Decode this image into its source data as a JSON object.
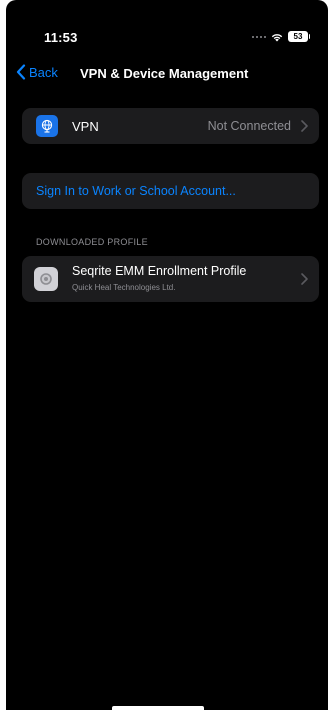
{
  "status_bar": {
    "time": "11:53",
    "battery": "53",
    "wifi_icon": "wifi-icon",
    "signal_icon": "cellular-signal-icon"
  },
  "nav": {
    "back_label": "Back",
    "back_icon": "chevron-left-icon",
    "title": "VPN & Device Management"
  },
  "vpn_row": {
    "icon": "globe-vpn-icon",
    "label": "VPN",
    "status": "Not Connected",
    "chevron": "chevron-right-icon"
  },
  "sign_in": {
    "label": "Sign In to Work or School Account..."
  },
  "downloaded_profile": {
    "header": "DOWNLOADED PROFILE",
    "items": [
      {
        "icon": "gear-icon",
        "title": "Seqrite EMM Enrollment Profile",
        "subtitle": "Quick Heal Technologies Ltd.",
        "chevron": "chevron-right-icon"
      }
    ]
  },
  "colors": {
    "background": "#000000",
    "cell_background": "#1c1c1e",
    "accent": "#0a84ff",
    "secondary_text": "#8e8e93",
    "vpn_icon_bg": "#1a73e8"
  }
}
